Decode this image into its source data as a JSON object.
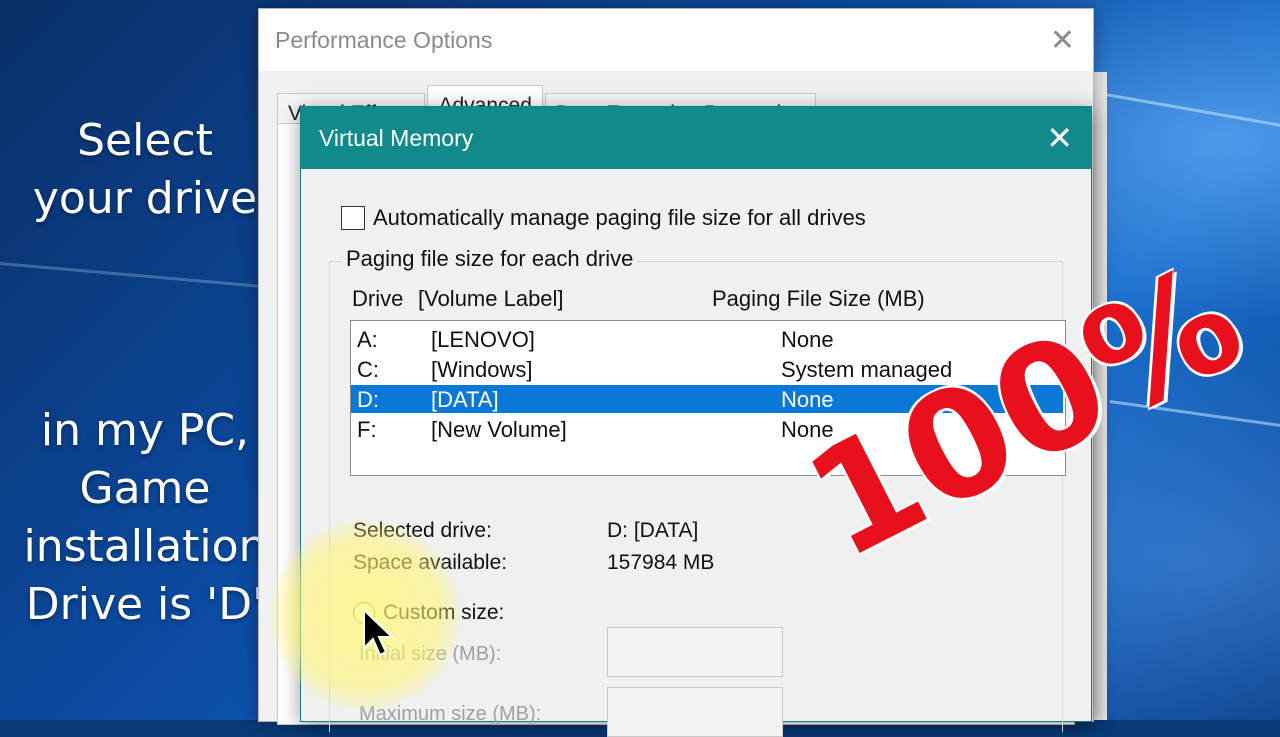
{
  "overlay": {
    "line1": "Select",
    "line2": "your drive",
    "line3": "in my PC,",
    "line4": "Game",
    "line5": "installation",
    "line6": "Drive is 'D'",
    "percent": "100%"
  },
  "performance_window": {
    "title": "Performance Options",
    "close_label": "✕",
    "tabs": [
      {
        "label": "Visual Effects"
      },
      {
        "label": "Advanced"
      },
      {
        "label": "Data Execution Prevention"
      }
    ]
  },
  "virtual_memory": {
    "title": "Virtual Memory",
    "close_label": "✕",
    "auto_manage_label": "Automatically manage paging file size for all drives",
    "group_label": "Paging file size for each drive",
    "column_drive": "Drive",
    "column_volume": "[Volume Label]",
    "column_size": "Paging File Size (MB)",
    "drives": [
      {
        "letter": "A:",
        "label": "[LENOVO]",
        "size": "None"
      },
      {
        "letter": "C:",
        "label": "[Windows]",
        "size": "System managed"
      },
      {
        "letter": "D:",
        "label": "[DATA]",
        "size": "None"
      },
      {
        "letter": "F:",
        "label": "[New Volume]",
        "size": "None"
      }
    ],
    "selected_drive_label": "Selected drive:",
    "selected_drive_value": "D:  [DATA]",
    "space_available_label": "Space available:",
    "space_available_value": "157984 MB",
    "custom_size_label": "Custom size:",
    "initial_size_label": "Initial size (MB):",
    "maximum_size_label": "Maximum size (MB):"
  },
  "colors": {
    "dialog_title_bar": "#108a8a",
    "selection": "#0a78d7",
    "overlay_percent": "#e8101c"
  }
}
